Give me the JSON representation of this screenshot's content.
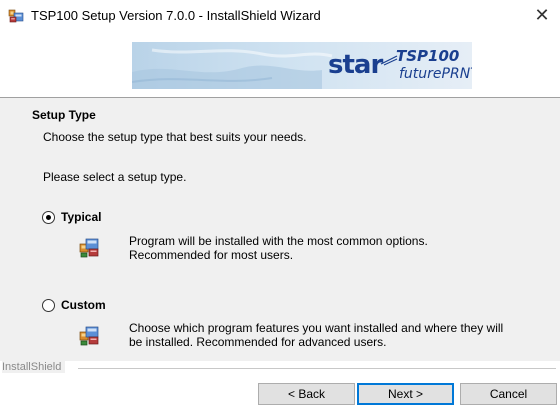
{
  "window": {
    "title": "TSP100 Setup Version 7.0.0 - InstallShield Wizard",
    "app_icon": "installer-icon",
    "close_glyph": "✕"
  },
  "banner": {
    "brand": "star",
    "product": "TSP100",
    "product_sub": "futurePRNT",
    "brand_color": "#1a3f8f"
  },
  "page": {
    "heading": "Setup Type",
    "subheading": "Choose the setup type that best suits your needs.",
    "prompt": "Please select a setup type."
  },
  "options": [
    {
      "label": "Typical",
      "selected": true,
      "description_line1": "Program will be installed with the most common options.",
      "description_line2": "Recommended for most users.",
      "icon": "typical-setup-icon"
    },
    {
      "label": "Custom",
      "selected": false,
      "description_line1": "Choose which program features you want installed and where they will",
      "description_line2": "be installed. Recommended for advanced users.",
      "icon": "custom-setup-icon"
    }
  ],
  "footer": {
    "brand": "InstallShield",
    "back_label": "< Back",
    "next_label": "Next >",
    "cancel_label": "Cancel"
  },
  "colors": {
    "panel_bg": "#f0f0f0",
    "button_bg": "#e1e1e1",
    "default_button_border": "#0078d7"
  }
}
